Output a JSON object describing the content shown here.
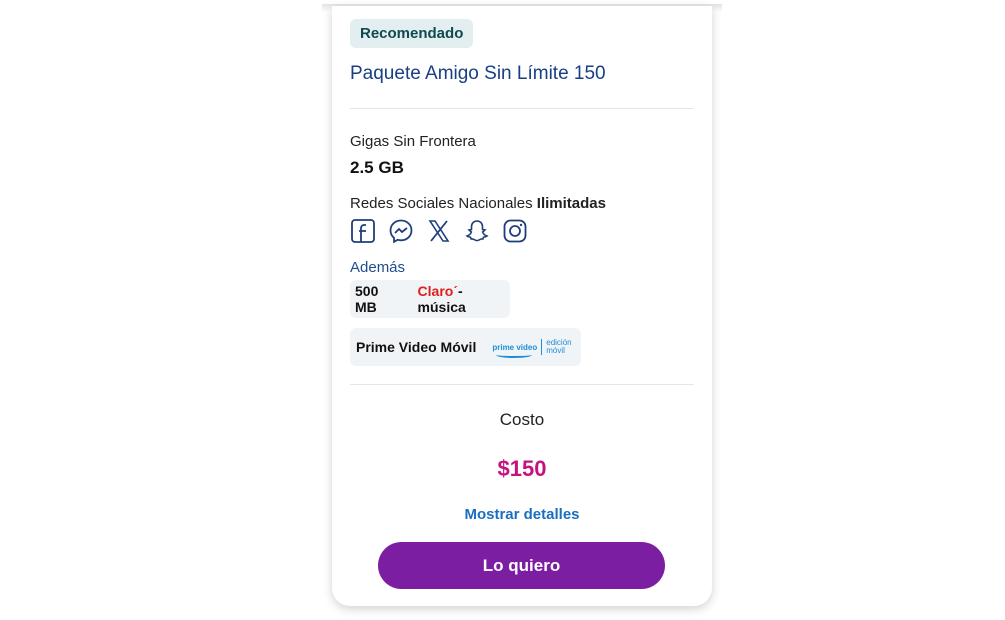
{
  "plan": {
    "badge": "Recomendado",
    "title": "Paquete Amigo Sin Límite 150",
    "gigas_label": "Gigas Sin Frontera",
    "gigas_value": "2.5 GB",
    "social_label": "Redes Sociales Nacionales ",
    "social_bold": "Ilimitadas",
    "social_icons": [
      "facebook-icon",
      "messenger-icon",
      "x-icon",
      "snapchat-icon",
      "instagram-icon"
    ],
    "ademas_label": "Además",
    "extras": [
      {
        "text": "500 MB",
        "logo_brand": "Claro",
        "logo_suffix": "música"
      },
      {
        "text": "Prime Video Móvil",
        "logo_main": "prime video",
        "logo_sub_1": "edición",
        "logo_sub_2": "móvil"
      }
    ],
    "cost_label": "Costo",
    "price": "$150",
    "details_link": "Mostrar detalles",
    "cta_label": "Lo quiero"
  },
  "colors": {
    "title": "#173f84",
    "price": "#c4137e",
    "cta": "#7b1ea2",
    "link": "#1a6fc0"
  }
}
